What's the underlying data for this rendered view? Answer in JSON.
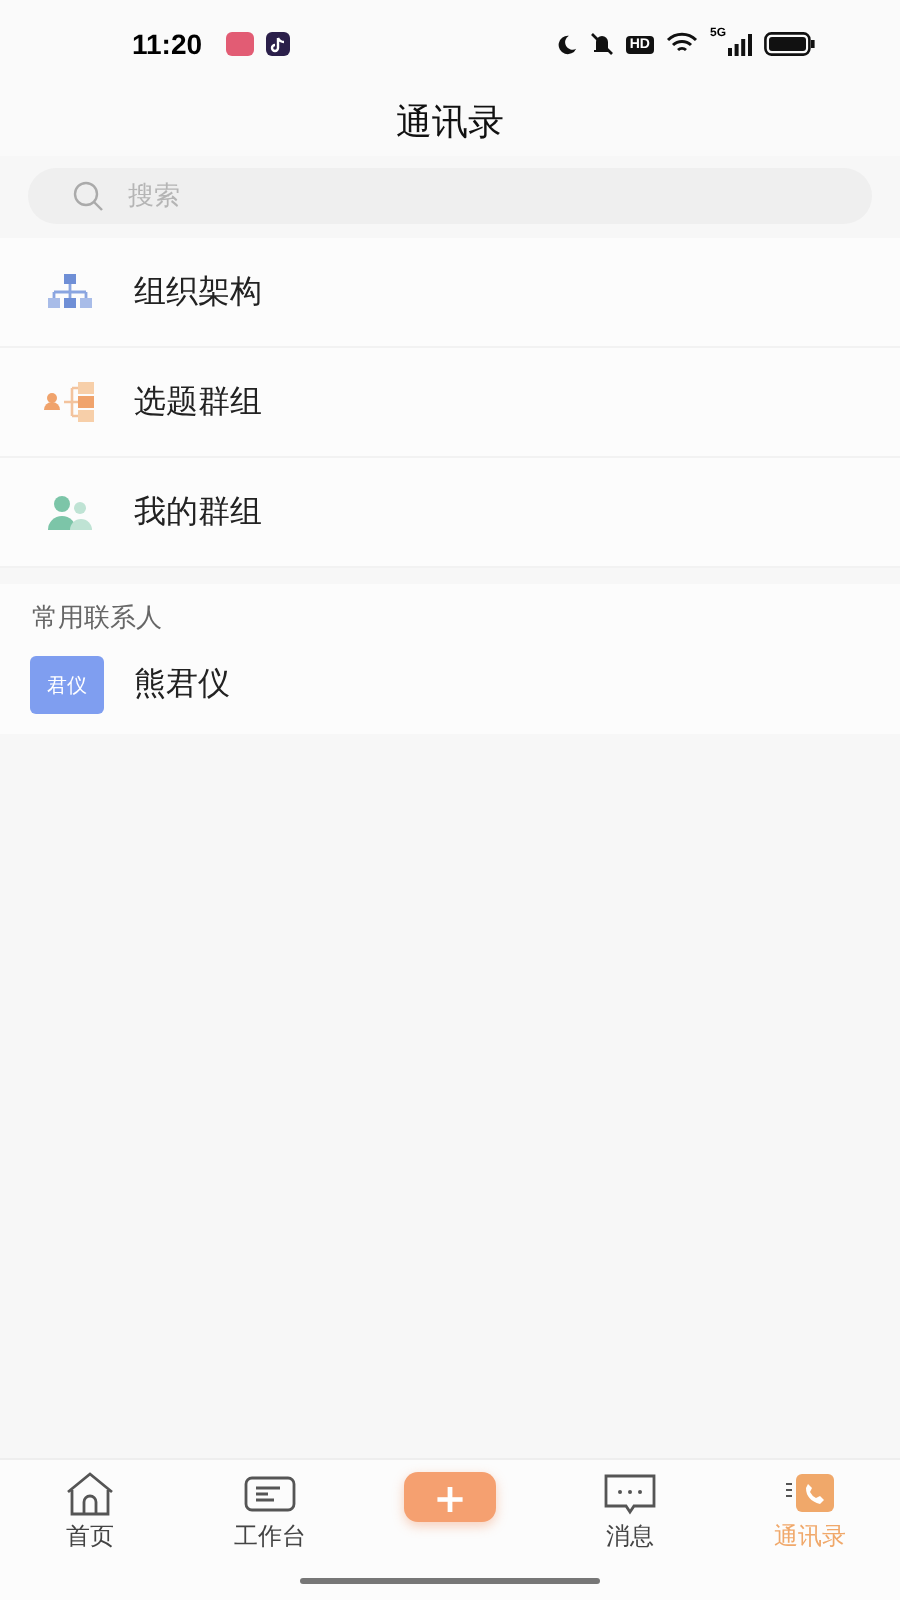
{
  "status_bar": {
    "time": "11:20",
    "hd_badge": "HD",
    "network": "5G"
  },
  "header": {
    "title": "通讯录"
  },
  "search": {
    "placeholder": "搜索"
  },
  "menu": [
    {
      "label": "组织架构",
      "kind": "org"
    },
    {
      "label": "选题群组",
      "kind": "topic"
    },
    {
      "label": "我的群组",
      "kind": "group"
    }
  ],
  "contacts_section": {
    "title": "常用联系人",
    "contacts": [
      {
        "avatar": "君仪",
        "name": "熊君仪"
      }
    ]
  },
  "tab_bar": [
    {
      "label": "首页",
      "kind": "home",
      "selected": false
    },
    {
      "label": "工作台",
      "kind": "desk",
      "selected": false
    },
    {
      "label": "+",
      "kind": "add",
      "selected": false
    },
    {
      "label": "消息",
      "kind": "chat",
      "selected": false
    },
    {
      "label": "通讯录",
      "kind": "contacts",
      "selected": true
    }
  ]
}
